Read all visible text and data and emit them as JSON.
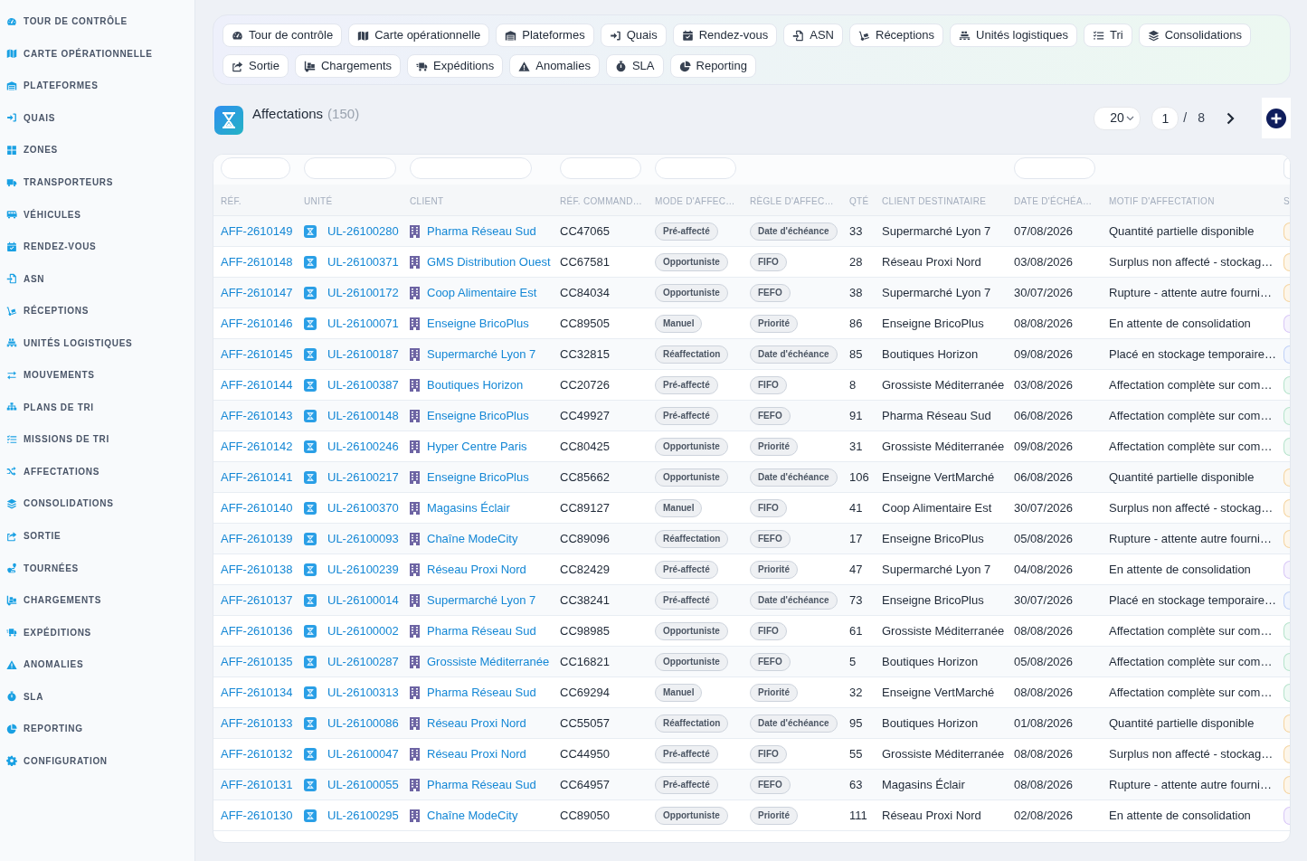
{
  "sidebar": {
    "items": [
      {
        "label": "TOUR DE CONTRÔLE",
        "selected": false
      },
      {
        "label": "CARTE OPÉRATIONNELLE",
        "selected": false
      },
      {
        "label": "PLATEFORMES",
        "selected": false
      },
      {
        "label": "QUAIS",
        "selected": false
      },
      {
        "label": "ZONES",
        "selected": false
      },
      {
        "label": "TRANSPORTEURS",
        "selected": false
      },
      {
        "label": "VÉHICULES",
        "selected": false
      },
      {
        "label": "RENDEZ-VOUS",
        "selected": false
      },
      {
        "label": "ASN",
        "selected": false
      },
      {
        "label": "RÉCEPTIONS",
        "selected": false
      },
      {
        "label": "UNITÉS LOGISTIQUES",
        "selected": false
      },
      {
        "label": "MOUVEMENTS",
        "selected": false
      },
      {
        "label": "PLANS DE TRI",
        "selected": false
      },
      {
        "label": "MISSIONS DE TRI",
        "selected": false
      },
      {
        "label": "AFFECTATIONS",
        "selected": false
      },
      {
        "label": "CONSOLIDATIONS",
        "selected": false
      },
      {
        "label": "SORTIE",
        "selected": false
      },
      {
        "label": "TOURNÉES",
        "selected": false
      },
      {
        "label": "CHARGEMENTS",
        "selected": false
      },
      {
        "label": "EXPÉDITIONS",
        "selected": false
      },
      {
        "label": "ANOMALIES",
        "selected": false
      },
      {
        "label": "SLA",
        "selected": false
      },
      {
        "label": "REPORTING",
        "selected": false
      },
      {
        "label": "CONFIGURATION",
        "selected": false
      }
    ]
  },
  "nav": {
    "items": [
      {
        "label": "Tour de contrôle",
        "selected": false
      },
      {
        "label": "Carte opérationnelle",
        "selected": false
      },
      {
        "label": "Plateformes",
        "selected": false
      },
      {
        "label": "Quais",
        "selected": false
      },
      {
        "label": "Rendez-vous",
        "selected": false
      },
      {
        "label": "ASN",
        "selected": false
      },
      {
        "label": "Réceptions",
        "selected": false
      },
      {
        "label": "Unités logistiques",
        "selected": false
      },
      {
        "label": "Tri",
        "selected": false
      },
      {
        "label": "Consolidations",
        "selected": false
      },
      {
        "label": "Sortie",
        "selected": false
      },
      {
        "label": "Chargements",
        "selected": false
      },
      {
        "label": "Expéditions",
        "selected": false
      },
      {
        "label": "Anomalies",
        "selected": false
      },
      {
        "label": "SLA",
        "selected": false
      },
      {
        "label": "Reporting",
        "selected": false
      }
    ]
  },
  "header": {
    "title": "Affectations",
    "count": "(150)",
    "page_size": "20",
    "page": "1",
    "separator": "/",
    "page_count": "8"
  },
  "table": {
    "columns": [
      {
        "label": "RÉF.",
        "filter": true
      },
      {
        "label": "UNITÉ",
        "filter": true
      },
      {
        "label": "CLIENT",
        "filter": true
      },
      {
        "label": "RÉF. COMMAND…",
        "filter": true
      },
      {
        "label": "MODE D'AFFEC…",
        "filter": true
      },
      {
        "label": "RÈGLE D'AFFEC…",
        "filter": false
      },
      {
        "label": "QTÉ",
        "filter": false
      },
      {
        "label": "CLIENT DESTINATAIRE",
        "filter": false
      },
      {
        "label": "DATE D'ÉCHÉA…",
        "filter": true
      },
      {
        "label": "MOTIF D'AFFECTATION",
        "filter": false
      },
      {
        "label": "S",
        "filter": true
      }
    ],
    "rows": [
      {
        "ref": "AFF-2610149",
        "unit": "UL-26100280",
        "client": "Pharma Réseau Sud",
        "order_ref": "CC47065",
        "mode": "Pré-affecté",
        "rule": "Date d'échéance",
        "qty": "33",
        "recipient": "Supermarché Lyon 7",
        "due_date": "07/08/2026",
        "reason": "Quantité partielle disponible",
        "status_badge": {
          "color": "#f5d49f"
        }
      },
      {
        "ref": "AFF-2610148",
        "unit": "UL-26100371",
        "client": "GMS Distribution Ouest",
        "order_ref": "CC67581",
        "mode": "Opportuniste",
        "rule": "FIFO",
        "qty": "28",
        "recipient": "Réseau Proxi Nord",
        "due_date": "03/08/2026",
        "reason": "Surplus non affecté - stockag…",
        "status_badge": {
          "color": "#f5d49f"
        }
      },
      {
        "ref": "AFF-2610147",
        "unit": "UL-26100172",
        "client": "Coop Alimentaire Est",
        "order_ref": "CC84034",
        "mode": "Opportuniste",
        "rule": "FEFO",
        "qty": "38",
        "recipient": "Supermarché Lyon 7",
        "due_date": "30/07/2026",
        "reason": "Rupture - attente autre fourni…",
        "status_badge": {
          "color": "#f5d49f"
        }
      },
      {
        "ref": "AFF-2610146",
        "unit": "UL-26100071",
        "client": "Enseigne BricoPlus",
        "order_ref": "CC89505",
        "mode": "Manuel",
        "rule": "Priorité",
        "qty": "86",
        "recipient": "Enseigne BricoPlus",
        "due_date": "08/08/2026",
        "reason": "En attente de consolidation",
        "status_badge": {
          "color": "#d8c7f7"
        }
      },
      {
        "ref": "AFF-2610145",
        "unit": "UL-26100187",
        "client": "Supermarché Lyon 7",
        "order_ref": "CC32815",
        "mode": "Réaffectation",
        "rule": "Date d'échéance",
        "qty": "85",
        "recipient": "Boutiques Horizon",
        "due_date": "09/08/2026",
        "reason": "Placé en stockage temporaire…",
        "status_badge": {
          "color": "#bfd0f7"
        }
      },
      {
        "ref": "AFF-2610144",
        "unit": "UL-26100387",
        "client": "Boutiques Horizon",
        "order_ref": "CC20726",
        "mode": "Pré-affecté",
        "rule": "FIFO",
        "qty": "8",
        "recipient": "Grossiste Méditerranée",
        "due_date": "03/08/2026",
        "reason": "Affectation complète sur com…",
        "status_badge": {
          "color": "#b5e3cb"
        }
      },
      {
        "ref": "AFF-2610143",
        "unit": "UL-26100148",
        "client": "Enseigne BricoPlus",
        "order_ref": "CC49927",
        "mode": "Pré-affecté",
        "rule": "FEFO",
        "qty": "91",
        "recipient": "Pharma Réseau Sud",
        "due_date": "06/08/2026",
        "reason": "Affectation complète sur com…",
        "status_badge": {
          "color": "#b5e3cb"
        }
      },
      {
        "ref": "AFF-2610142",
        "unit": "UL-26100246",
        "client": "Hyper Centre Paris",
        "order_ref": "CC80425",
        "mode": "Opportuniste",
        "rule": "Priorité",
        "qty": "31",
        "recipient": "Grossiste Méditerranée",
        "due_date": "09/08/2026",
        "reason": "Affectation complète sur com…",
        "status_badge": {
          "color": "#b5e3cb"
        }
      },
      {
        "ref": "AFF-2610141",
        "unit": "UL-26100217",
        "client": "Enseigne BricoPlus",
        "order_ref": "CC85662",
        "mode": "Opportuniste",
        "rule": "Date d'échéance",
        "qty": "106",
        "recipient": "Enseigne VertMarché",
        "due_date": "06/08/2026",
        "reason": "Quantité partielle disponible",
        "status_badge": {
          "color": "#f5d49f"
        }
      },
      {
        "ref": "AFF-2610140",
        "unit": "UL-26100370",
        "client": "Magasins Éclair",
        "order_ref": "CC89127",
        "mode": "Manuel",
        "rule": "FIFO",
        "qty": "41",
        "recipient": "Coop Alimentaire Est",
        "due_date": "30/07/2026",
        "reason": "Surplus non affecté - stockag…",
        "status_badge": {
          "color": "#f5d49f"
        }
      },
      {
        "ref": "AFF-2610139",
        "unit": "UL-26100093",
        "client": "Chaîne ModeCity",
        "order_ref": "CC89096",
        "mode": "Réaffectation",
        "rule": "FEFO",
        "qty": "17",
        "recipient": "Enseigne BricoPlus",
        "due_date": "05/08/2026",
        "reason": "Rupture - attente autre fourni…",
        "status_badge": {
          "color": "#f5d49f"
        }
      },
      {
        "ref": "AFF-2610138",
        "unit": "UL-26100239",
        "client": "Réseau Proxi Nord",
        "order_ref": "CC82429",
        "mode": "Pré-affecté",
        "rule": "Priorité",
        "qty": "47",
        "recipient": "Supermarché Lyon 7",
        "due_date": "04/08/2026",
        "reason": "En attente de consolidation",
        "status_badge": {
          "color": "#d8c7f7"
        }
      },
      {
        "ref": "AFF-2610137",
        "unit": "UL-26100014",
        "client": "Supermarché Lyon 7",
        "order_ref": "CC38241",
        "mode": "Pré-affecté",
        "rule": "Date d'échéance",
        "qty": "73",
        "recipient": "Enseigne BricoPlus",
        "due_date": "30/07/2026",
        "reason": "Placé en stockage temporaire…",
        "status_badge": {
          "color": "#bfd0f7"
        }
      },
      {
        "ref": "AFF-2610136",
        "unit": "UL-26100002",
        "client": "Pharma Réseau Sud",
        "order_ref": "CC98985",
        "mode": "Opportuniste",
        "rule": "FIFO",
        "qty": "61",
        "recipient": "Grossiste Méditerranée",
        "due_date": "08/08/2026",
        "reason": "Affectation complète sur com…",
        "status_badge": {
          "color": "#b5e3cb"
        }
      },
      {
        "ref": "AFF-2610135",
        "unit": "UL-26100287",
        "client": "Grossiste Méditerranée",
        "order_ref": "CC16821",
        "mode": "Opportuniste",
        "rule": "FEFO",
        "qty": "5",
        "recipient": "Boutiques Horizon",
        "due_date": "05/08/2026",
        "reason": "Affectation complète sur com…",
        "status_badge": {
          "color": "#b5e3cb"
        }
      },
      {
        "ref": "AFF-2610134",
        "unit": "UL-26100313",
        "client": "Pharma Réseau Sud",
        "order_ref": "CC69294",
        "mode": "Manuel",
        "rule": "Priorité",
        "qty": "32",
        "recipient": "Enseigne VertMarché",
        "due_date": "08/08/2026",
        "reason": "Affectation complète sur com…",
        "status_badge": {
          "color": "#b5e3cb"
        }
      },
      {
        "ref": "AFF-2610133",
        "unit": "UL-26100086",
        "client": "Réseau Proxi Nord",
        "order_ref": "CC55057",
        "mode": "Réaffectation",
        "rule": "Date d'échéance",
        "qty": "95",
        "recipient": "Boutiques Horizon",
        "due_date": "01/08/2026",
        "reason": "Quantité partielle disponible",
        "status_badge": {
          "color": "#f5d49f"
        }
      },
      {
        "ref": "AFF-2610132",
        "unit": "UL-26100047",
        "client": "Réseau Proxi Nord",
        "order_ref": "CC44950",
        "mode": "Pré-affecté",
        "rule": "FIFO",
        "qty": "55",
        "recipient": "Grossiste Méditerranée",
        "due_date": "08/08/2026",
        "reason": "Surplus non affecté - stockag…",
        "status_badge": {
          "color": "#f5d49f"
        }
      },
      {
        "ref": "AFF-2610131",
        "unit": "UL-26100055",
        "client": "Pharma Réseau Sud",
        "order_ref": "CC64957",
        "mode": "Pré-affecté",
        "rule": "FEFO",
        "qty": "63",
        "recipient": "Magasins Éclair",
        "due_date": "08/08/2026",
        "reason": "Rupture - attente autre fourni…",
        "status_badge": {
          "color": "#f5d49f"
        }
      },
      {
        "ref": "AFF-2610130",
        "unit": "UL-26100295",
        "client": "Chaîne ModeCity",
        "order_ref": "CC89050",
        "mode": "Opportuniste",
        "rule": "Priorité",
        "qty": "111",
        "recipient": "Réseau Proxi Nord",
        "due_date": "02/08/2026",
        "reason": "En attente de consolidation",
        "status_badge": {
          "color": "#d8c7f7"
        }
      }
    ]
  }
}
